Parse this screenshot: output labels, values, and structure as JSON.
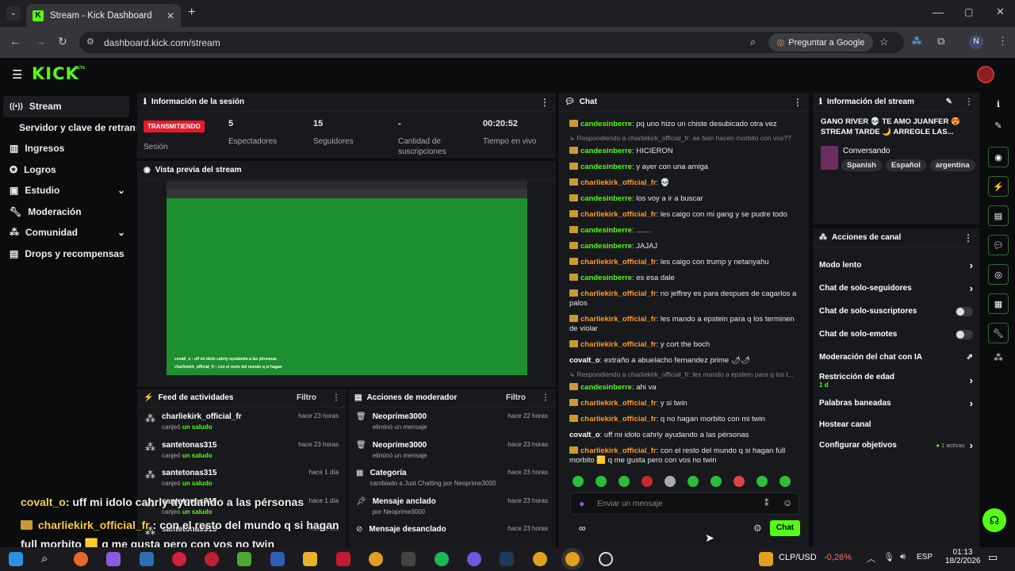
{
  "browser": {
    "tab_title": "Stream - Kick Dashboard",
    "url": "dashboard.kick.com/stream",
    "ask_google": "Preguntar a Google",
    "profile_initial": "N"
  },
  "brand": {
    "logo": "KICK",
    "beta": "BETA",
    "accent": "#53fc18"
  },
  "sidebar": {
    "items": [
      {
        "label": "Stream"
      },
      {
        "label": "Servidor y clave de retransm"
      },
      {
        "label": "Ingresos"
      },
      {
        "label": "Logros"
      },
      {
        "label": "Estudio"
      },
      {
        "label": "Moderación"
      },
      {
        "label": "Comunidad"
      },
      {
        "label": "Drops y recompensas"
      }
    ]
  },
  "session": {
    "title": "Información de la sesión",
    "status_badge": "TRANSMITIENDO",
    "status_label": "Sesión",
    "stats": [
      {
        "value": "5",
        "label": "Espectadores"
      },
      {
        "value": "15",
        "label": "Seguidores"
      },
      {
        "value": "-",
        "label": "Cantidad de suscripciones"
      },
      {
        "value": "00:20:52",
        "label": "Tiempo en vivo"
      }
    ]
  },
  "preview": {
    "title": "Vista previa del stream"
  },
  "activity_feed": {
    "title": "Feed de actividades",
    "filter": "Filtro",
    "items": [
      {
        "user": "charliekirk_official_fr",
        "action": "canjeó",
        "reward": "un saludo",
        "time": "hace 23 horas"
      },
      {
        "user": "santetonas315",
        "action": "canjeó",
        "reward": "un saludo",
        "time": "hace 23 horas"
      },
      {
        "user": "santetonas315",
        "action": "canjeó",
        "reward": "un saludo",
        "time": "hace 1 día"
      },
      {
        "user": "santetonas315",
        "action": "canjeó",
        "reward": "un saludo",
        "time": "hace 1 día"
      },
      {
        "user": "santetonas315",
        "action": "",
        "reward": "",
        "time": "hace 1 día"
      }
    ]
  },
  "mod_actions": {
    "title": "Acciones de moderador",
    "filter": "Filtro",
    "items": [
      {
        "title": "Neoprime3000",
        "sub": "eliminó un mensaje",
        "time": "hace 22 horas"
      },
      {
        "title": "Neoprime3000",
        "sub": "eliminó un mensaje",
        "time": "hace 23 horas"
      },
      {
        "title": "Categoría",
        "sub": "cambiado a Just Chatting por Neoprime3000",
        "time": "hace 23 horas"
      },
      {
        "title": "Mensaje anclado",
        "sub": "por Neoprime3000",
        "time": "hace 23 horas"
      },
      {
        "title": "Mensaje desanclado",
        "sub": "",
        "time": "hace 23 horas"
      }
    ]
  },
  "chat": {
    "title": "Chat",
    "input_placeholder": "Enviar un mensaje",
    "send_label": "Chat",
    "messages": [
      {
        "user": "candesinberre",
        "color": "green",
        "crown": true,
        "text": ": pq uno hizo un chiste desubicado otra vez"
      },
      {
        "reply": "Respondiendo a charliekirk_official_fr: ee twin hacen morbito con vos??"
      },
      {
        "user": "candesinberre",
        "color": "green",
        "crown": true,
        "text": ": HICIERON"
      },
      {
        "user": "candesinberre",
        "color": "green",
        "crown": true,
        "text": ": y ayer con una amiga"
      },
      {
        "user": "charliekirk_official_fr",
        "color": "orange",
        "crown": true,
        "text": ": 💀"
      },
      {
        "user": "candesinberre",
        "color": "green",
        "crown": true,
        "text": ": los voy a ir a buscar"
      },
      {
        "user": "charliekirk_official_fr",
        "color": "orange",
        "crown": true,
        "text": ": les caigo con mi gang y se pudre todo"
      },
      {
        "user": "candesinberre",
        "color": "green",
        "crown": true,
        "text": ": ......."
      },
      {
        "user": "candesinberre",
        "color": "green",
        "crown": true,
        "text": ": JAJAJ"
      },
      {
        "user": "charliekirk_official_fr",
        "color": "orange",
        "crown": true,
        "text": ": les caigo con trump y netanyahu"
      },
      {
        "user": "candesinberre",
        "color": "green",
        "crown": true,
        "text": ": es esa dale"
      },
      {
        "user": "charliekirk_official_fr",
        "color": "orange",
        "crown": true,
        "text": ": no jeffrey es para despues de cagarlos a palos"
      },
      {
        "user": "charliekirk_official_fr",
        "color": "orange",
        "crown": true,
        "text": ": les mando a epstein para q los terminen de violar"
      },
      {
        "user": "charliekirk_official_fr",
        "color": "orange",
        "crown": true,
        "text": ": y cort the boch"
      },
      {
        "user": "covalt_o",
        "color": "white",
        "crown": false,
        "text": ": extraño a abuelacho fernandez prime 🌶🌶"
      },
      {
        "reply": "Respondiendo a charliekirk_official_fr: les mando a epstein para q los t..."
      },
      {
        "user": "candesinberre",
        "color": "green",
        "crown": true,
        "text": ": ahi va"
      },
      {
        "user": "charliekirk_official_fr",
        "color": "orange",
        "crown": true,
        "text": ": y si twin"
      },
      {
        "user": "charliekirk_official_fr",
        "color": "orange",
        "crown": true,
        "text": ": q no hagan morbito con mi twin"
      },
      {
        "user": "covalt_o",
        "color": "white",
        "crown": false,
        "text": ": uff mi idolo cahrly ayudando a las pérsonas"
      },
      {
        "user": "charliekirk_official_fr",
        "color": "orange",
        "crown": true,
        "text": ": con el resto del mundo q si hagan full morbito 🟨 q me gusta pero con vos no twin"
      }
    ],
    "footer_symbol": "∞"
  },
  "stream_info": {
    "title": "Información del stream",
    "stream_title": "GANO RIVER 💀 TE AMO JUANFER 😍 STREAM TARDE 🌙 ARREGLE LAS...",
    "category": "Conversando",
    "tags": [
      "Spanish",
      "Español",
      "argentina"
    ]
  },
  "channel_actions": {
    "title": "Acciones de canal",
    "rows": [
      {
        "label": "Modo lento",
        "control": "chevron"
      },
      {
        "label": "Chat de solo-seguidores",
        "control": "chevron"
      },
      {
        "label": "Chat de solo-suscriptores",
        "control": "toggle"
      },
      {
        "label": "Chat de solo-emotes",
        "control": "toggle"
      },
      {
        "label": "Moderación del chat con IA",
        "control": "external"
      },
      {
        "label": "Restricción de edad",
        "sub": "1 d",
        "control": "chevron"
      },
      {
        "label": "Palabras baneadas",
        "control": "chevron"
      },
      {
        "label": "Hostear canal",
        "control": "none"
      },
      {
        "label": "Configurar objetivos",
        "sub": "1 activas",
        "control": "chevron"
      }
    ]
  },
  "overlay": {
    "line1_user": "covalt_o",
    "line1_text": ": uff mi idolo cahrly ayudando a las pérsonas",
    "line2_user": "charliekirk_official_fr",
    "line2_text": ": con el resto del mundo q si hagan",
    "line3_text": "full morbito 🟨 q me gusta pero con vos no twin"
  },
  "taskbar": {
    "ticker_label": "CLP/USD",
    "ticker_value": "-0,26%",
    "lang": "ESP",
    "time": "01:13",
    "date": "18/2/2026"
  }
}
